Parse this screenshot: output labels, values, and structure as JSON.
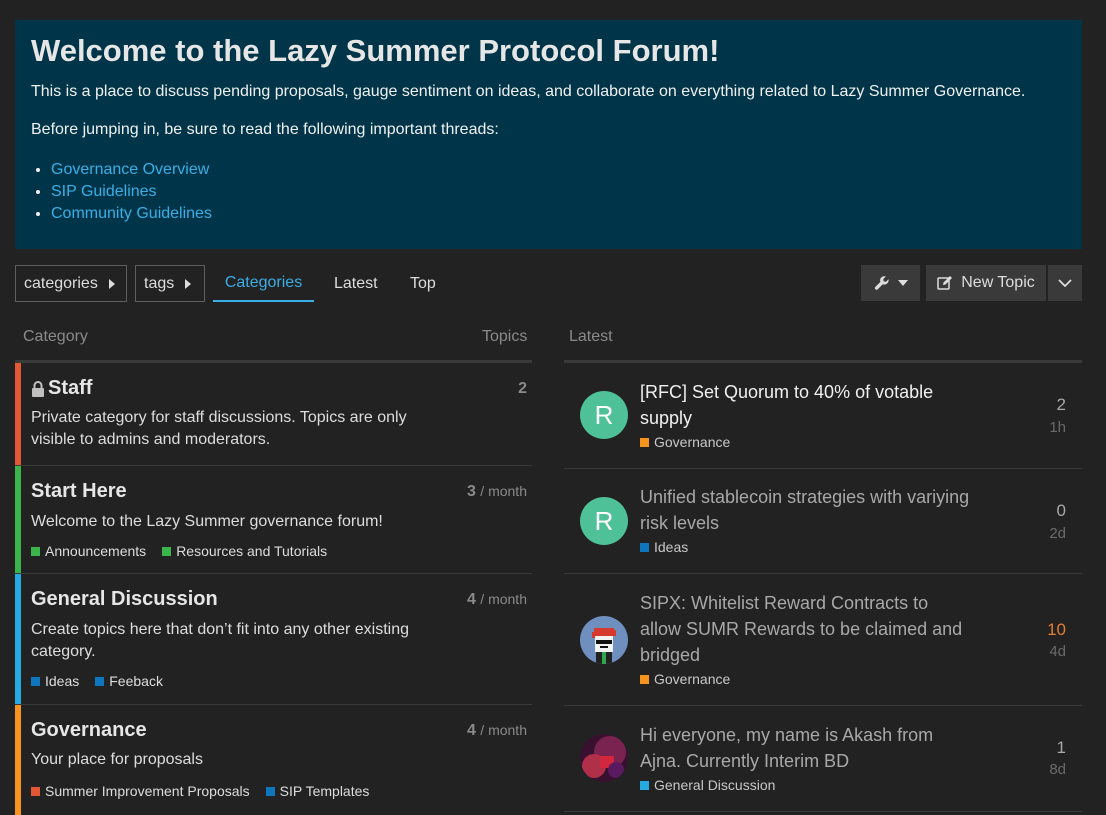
{
  "banner": {
    "title": "Welcome to the Lazy Summer Protocol Forum!",
    "intro": "This is a place to discuss pending proposals, gauge sentiment on ideas, and collaborate on everything related to Lazy Summer Governance.",
    "before": "Before jumping in, be sure to read the following important threads:",
    "links": [
      "Governance Overview",
      "SIP Guidelines",
      "Community Guidelines"
    ]
  },
  "nav": {
    "categories_dropdown": "categories",
    "tags_dropdown": "tags",
    "tabs": [
      "Categories",
      "Latest",
      "Top"
    ],
    "new_topic": "New Topic"
  },
  "columns": {
    "category": "Category",
    "topics": "Topics",
    "latest": "Latest"
  },
  "categories": [
    {
      "name": "Staff",
      "description": "Private category for staff discussions. Topics are only visible to admins and moderators.",
      "count": "2",
      "per": "",
      "color": "#e45735",
      "locked": true,
      "subcategories": []
    },
    {
      "name": "Start Here",
      "description": "Welcome to the Lazy Summer governance forum!",
      "count": "3",
      "per": "/ month",
      "color": "#3ab54a",
      "subcategories": [
        {
          "name": "Announcements",
          "color": "#3ab54a"
        },
        {
          "name": "Resources and Tutorials",
          "color": "#3ab54a"
        }
      ]
    },
    {
      "name": "General Discussion",
      "description": "Create topics here that don’t fit into any other existing category.",
      "count": "4",
      "per": "/ month",
      "color": "#25aae2",
      "subcategories": [
        {
          "name": "Ideas",
          "color": "#0e76bd"
        },
        {
          "name": "Feeback",
          "color": "#0e76bd"
        }
      ]
    },
    {
      "name": "Governance",
      "description": "Your place for proposals",
      "count": "4",
      "per": "/ month",
      "color": "#f7941d",
      "subcategories": [
        {
          "name": "Summer Improvement Proposals",
          "color": "#e45735"
        },
        {
          "name": "SIP Templates",
          "color": "#0e76bd"
        }
      ]
    }
  ],
  "latest": [
    {
      "title": "[RFC] Set Quorum to 40% of votable supply",
      "category": "Governance",
      "category_color": "#f7941d",
      "replies": "2",
      "age": "1h",
      "avatar_letter": "R",
      "avatar_color": "#4fc198",
      "unread": true,
      "hot": false
    },
    {
      "title": "Unified stablecoin strategies with variying risk levels",
      "category": "Ideas",
      "category_color": "#0e76bd",
      "replies": "0",
      "age": "2d",
      "avatar_letter": "R",
      "avatar_color": "#4fc198",
      "unread": false,
      "hot": false
    },
    {
      "title": "SIPX: Whitelist Reward Contracts to allow SUMR Rewards to be claimed and bridged",
      "category": "Governance",
      "category_color": "#f7941d",
      "replies": "10",
      "age": "4d",
      "avatar_letter": "",
      "avatar_color": "#6f8fbf",
      "unread": false,
      "hot": true
    },
    {
      "title": "Hi everyone, my name is Akash from Ajna. Currently Interim BD",
      "category": "General Discussion",
      "category_color": "#25aae2",
      "replies": "1",
      "age": "8d",
      "avatar_letter": "",
      "avatar_color": "#7a2350",
      "unread": false,
      "hot": false
    }
  ],
  "colors": {
    "banner_bg": "#003549",
    "link": "#3aaee6",
    "background": "#222222",
    "hot_count": "#e47c30"
  }
}
